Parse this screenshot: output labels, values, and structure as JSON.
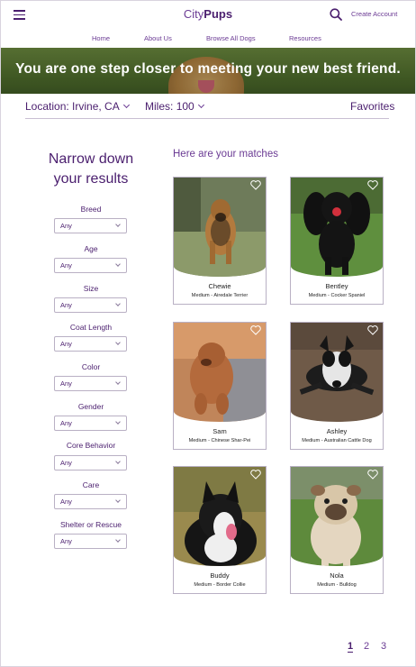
{
  "header": {
    "brand_light": "City",
    "brand_bold": "Pups",
    "create_account": "Create Account",
    "icons": {
      "menu": "hamburger-icon",
      "search": "search-icon"
    }
  },
  "nav": [
    "Home",
    "About Us",
    "Browse All Dogs",
    "Resources"
  ],
  "banner": {
    "text": "You are one step closer to meeting your new best friend."
  },
  "location": {
    "label": "Location:",
    "value": "Irvine, CA",
    "miles_label": "Miles:",
    "miles_value": "100",
    "favorites": "Favorites"
  },
  "filters": {
    "title": "Narrow down your results",
    "items": [
      {
        "label": "Breed",
        "value": "Any"
      },
      {
        "label": "Age",
        "value": "Any"
      },
      {
        "label": "Size",
        "value": "Any"
      },
      {
        "label": "Coat Length",
        "value": "Any"
      },
      {
        "label": "Color",
        "value": "Any"
      },
      {
        "label": "Gender",
        "value": "Any"
      },
      {
        "label": "Core Behavior",
        "value": "Any"
      },
      {
        "label": "Care",
        "value": "Any"
      },
      {
        "label": "Shelter or Rescue",
        "value": "Any"
      }
    ]
  },
  "results": {
    "title": "Here are your matches",
    "dogs": [
      {
        "name": "Chewie",
        "desc": "Medium - Airedale Terrier"
      },
      {
        "name": "Bentley",
        "desc": "Medium - Cocker Spaniel"
      },
      {
        "name": "Sam",
        "desc": "Medium - Chinese Shar-Pei"
      },
      {
        "name": "Ashley",
        "desc": "Medium - Australian Cattle Dog"
      },
      {
        "name": "Buddy",
        "desc": "Medium - Border Collie"
      },
      {
        "name": "Nola",
        "desc": "Medium - Bulldog"
      }
    ]
  },
  "pagination": {
    "pages": [
      "1",
      "2",
      "3"
    ],
    "current": "1"
  },
  "colors": {
    "primary": "#4a1e6e",
    "accent": "#6b3b94",
    "border": "#b9b0c4"
  }
}
